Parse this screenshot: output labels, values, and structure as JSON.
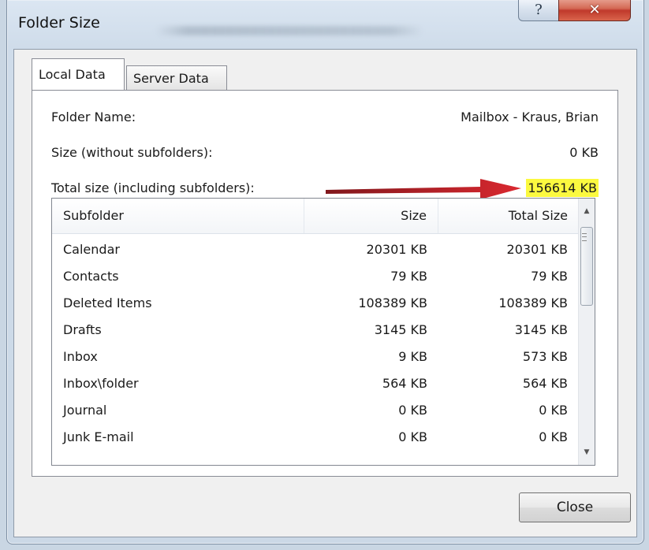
{
  "window": {
    "title": "Folder Size",
    "help_glyph": "?",
    "close_glyph": "✕"
  },
  "tabs": [
    {
      "label": "Local Data",
      "active": true
    },
    {
      "label": "Server Data",
      "active": false
    }
  ],
  "info": {
    "folder_name_label": "Folder Name:",
    "folder_name_value": "Mailbox - Kraus, Brian",
    "size_label": "Size (without subfolders):",
    "size_value": "0 KB",
    "total_label": "Total size (including subfolders):",
    "total_value": "156614 KB",
    "highlight_color": "#fbf93f",
    "arrow_color": "#c4161c"
  },
  "table": {
    "columns": [
      "Subfolder",
      "Size",
      "Total Size"
    ],
    "rows": [
      [
        "Calendar",
        "20301 KB",
        "20301 KB"
      ],
      [
        "Contacts",
        "79 KB",
        "79 KB"
      ],
      [
        "Deleted Items",
        "108389 KB",
        "108389 KB"
      ],
      [
        "Drafts",
        "3145 KB",
        "3145 KB"
      ],
      [
        "Inbox",
        "9 KB",
        "573 KB"
      ],
      [
        "Inbox\\folder",
        "564 KB",
        "564 KB"
      ],
      [
        "Journal",
        "0 KB",
        "0 KB"
      ],
      [
        "Junk E-mail",
        "0 KB",
        "0 KB"
      ]
    ],
    "scroll_up_icon": "▲",
    "scroll_down_icon": "▼"
  },
  "footer": {
    "close_label": "Close"
  }
}
